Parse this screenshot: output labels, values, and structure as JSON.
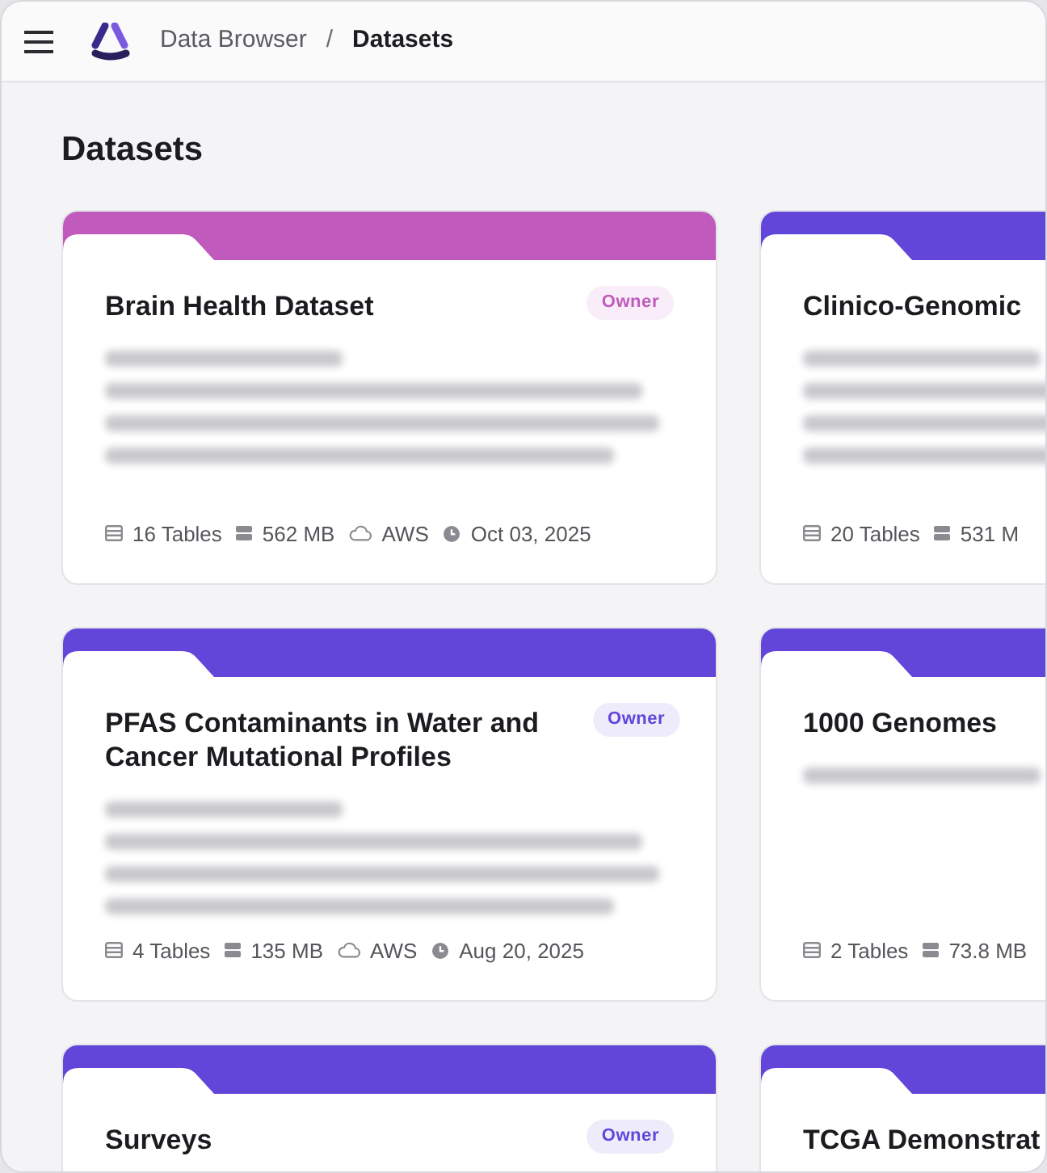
{
  "header": {
    "separator": "/",
    "breadcrumb": [
      {
        "label": "Data Browser",
        "current": false
      },
      {
        "label": "Datasets",
        "current": true
      }
    ]
  },
  "page_title": "Datasets",
  "cards": [
    {
      "title": "Brain Health Dataset",
      "color": "#c05bbd",
      "badge": "Owner",
      "description": {
        "kind": "paragraph"
      },
      "meta": [
        {
          "kind": "tables",
          "text": "16 Tables"
        },
        {
          "kind": "size",
          "text": "562 MB"
        },
        {
          "kind": "cloud",
          "text": "AWS"
        },
        {
          "kind": "date",
          "text": "Oct 03, 2025"
        }
      ]
    },
    {
      "title": "Clinico-Genomic",
      "color": "#6146d9",
      "description": {
        "kind": "paragraph"
      },
      "meta": [
        {
          "kind": "tables",
          "text": "20 Tables"
        },
        {
          "kind": "size",
          "text": "531 M"
        }
      ]
    },
    {
      "title": "PFAS Contaminants in Water and Cancer Mutational Profiles",
      "color": "#6146d9",
      "badge": "Owner",
      "description": {
        "kind": "paragraph"
      },
      "meta": [
        {
          "kind": "tables",
          "text": "4 Tables"
        },
        {
          "kind": "size",
          "text": "135 MB"
        },
        {
          "kind": "cloud",
          "text": "AWS"
        },
        {
          "kind": "date",
          "text": "Aug 20, 2025"
        }
      ]
    },
    {
      "title": "1000 Genomes",
      "color": "#6146d9",
      "description": {
        "kind": "line"
      },
      "meta": [
        {
          "kind": "tables",
          "text": "2 Tables"
        },
        {
          "kind": "size",
          "text": "73.8 MB"
        }
      ]
    },
    {
      "title": "Surveys",
      "color": "#6146d9",
      "badge": "Owner"
    },
    {
      "title": "TCGA Demonstrat",
      "color": "#6146d9"
    }
  ]
}
